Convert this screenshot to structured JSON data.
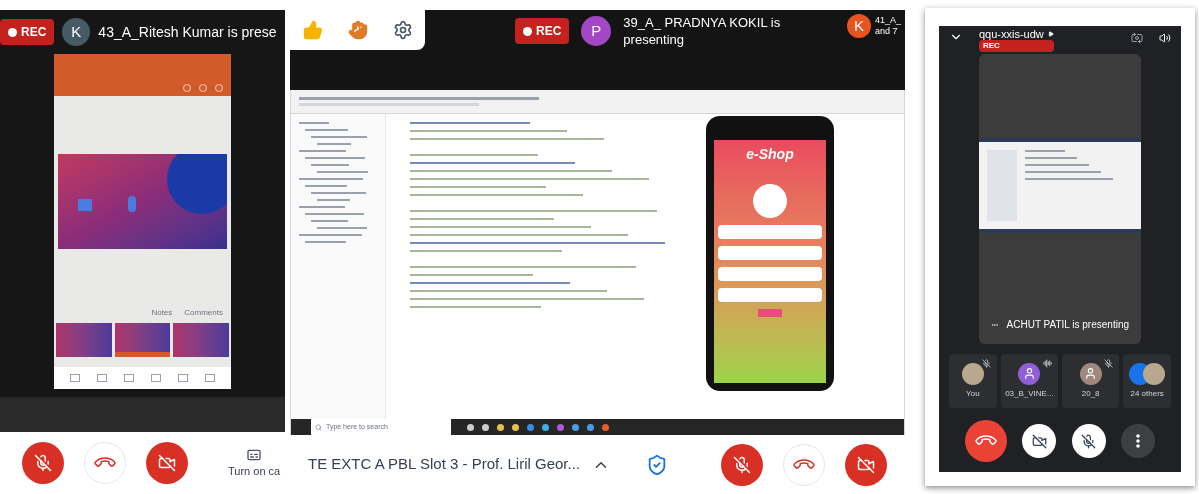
{
  "left_call": {
    "rec": "REC",
    "presenter": {
      "initial": "K",
      "color": "#455a64",
      "text": "43_A_Ritesh Kumar is prese"
    },
    "slides": {
      "notes": "Notes",
      "comments": "Comments",
      "thumbnails": [
        {
          "selected": false
        },
        {
          "selected": true
        },
        {
          "selected": false
        }
      ]
    },
    "controls": [
      {
        "kind": "mic",
        "on": false
      },
      {
        "kind": "hangup"
      },
      {
        "kind": "camera",
        "on": false
      }
    ],
    "captions": "Turn on ca"
  },
  "middle_call": {
    "reactions": [
      {
        "kind": "thumbs_up"
      },
      {
        "kind": "raised_hand"
      },
      {
        "kind": "settings"
      }
    ],
    "rec": "REC",
    "presenter": {
      "initial": "P",
      "color": "#a347c6",
      "line_1": "39_A_ PRADNYA KOKIL is",
      "line_2": "presenting"
    },
    "other": {
      "initial": "K",
      "color": "#e8531f",
      "line_1": "41_A_",
      "line_2": "and 7"
    },
    "screen": {
      "app_title": "e-Shop",
      "search_placeholder": "Type here to search"
    },
    "meeting_title": "TE EXTC A PBL Slot 3 - Prof. Liril Geor...",
    "controls": [
      {
        "kind": "mic",
        "on": false
      },
      {
        "kind": "hangup"
      },
      {
        "kind": "camera",
        "on": false
      }
    ]
  },
  "right_call": {
    "meeting_code": "qqu-xxis-udw",
    "rec": "REC",
    "presenting": "ACHUT PATIL is presenting",
    "participants": [
      {
        "name": "You",
        "kind": "photo",
        "muted": true,
        "speaking": false
      },
      {
        "name": "03_B_VINE...",
        "kind": "avatar",
        "color": "#8e5fd6",
        "muted": false,
        "speaking": true
      },
      {
        "name": "20_8",
        "kind": "avatar",
        "color": "#a1887f",
        "muted": true,
        "speaking": false
      },
      {
        "name": "24 others",
        "kind": "group",
        "muted": false,
        "speaking": false
      }
    ],
    "controls": [
      {
        "kind": "hangup"
      },
      {
        "kind": "camera",
        "on": false
      },
      {
        "kind": "mic",
        "on": false
      },
      {
        "kind": "more"
      }
    ]
  }
}
